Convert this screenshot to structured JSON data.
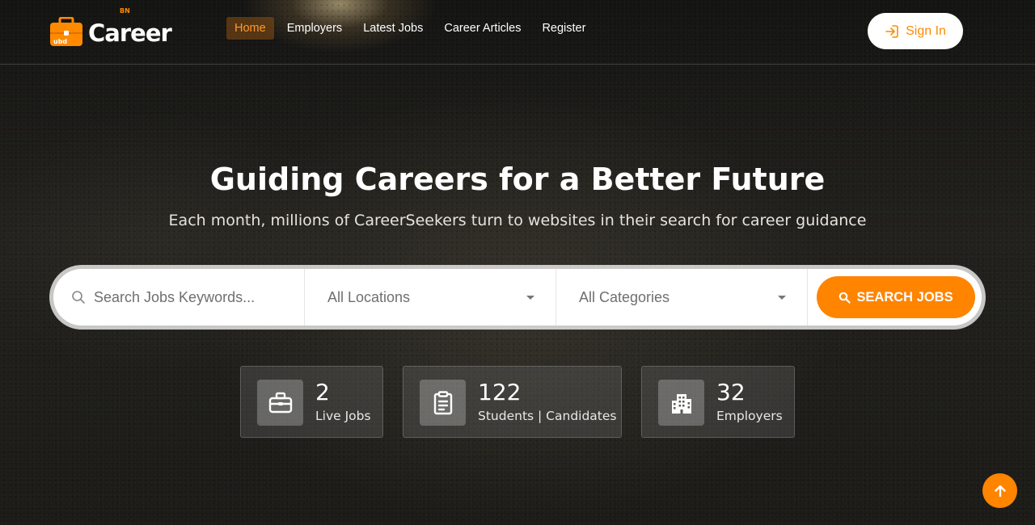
{
  "header": {
    "logo_text": "Career",
    "logo_sup": "BN",
    "logo_bag_text": "ubd",
    "nav": [
      {
        "label": "Home",
        "active": true
      },
      {
        "label": "Employers",
        "active": false
      },
      {
        "label": "Latest Jobs",
        "active": false
      },
      {
        "label": "Career Articles",
        "active": false
      },
      {
        "label": "Register",
        "active": false
      }
    ],
    "signin_label": "Sign In"
  },
  "hero": {
    "title": "Guiding Careers for a Better Future",
    "subtitle": "Each month, millions of CareerSeekers turn to websites in their search for career guidance"
  },
  "search": {
    "keyword_placeholder": "Search Jobs Keywords...",
    "location_value": "All Locations",
    "category_value": "All Categories",
    "button_label": "SEARCH JOBS"
  },
  "stats": [
    {
      "icon": "briefcase-icon",
      "value": "2",
      "label": "Live Jobs"
    },
    {
      "icon": "clipboard-icon",
      "value": "122",
      "label": "Students | Candidates"
    },
    {
      "icon": "building-icon",
      "value": "32",
      "label": "Employers"
    }
  ],
  "colors": {
    "accent": "#ff8400",
    "nav_active_text": "#ff9a2a"
  }
}
